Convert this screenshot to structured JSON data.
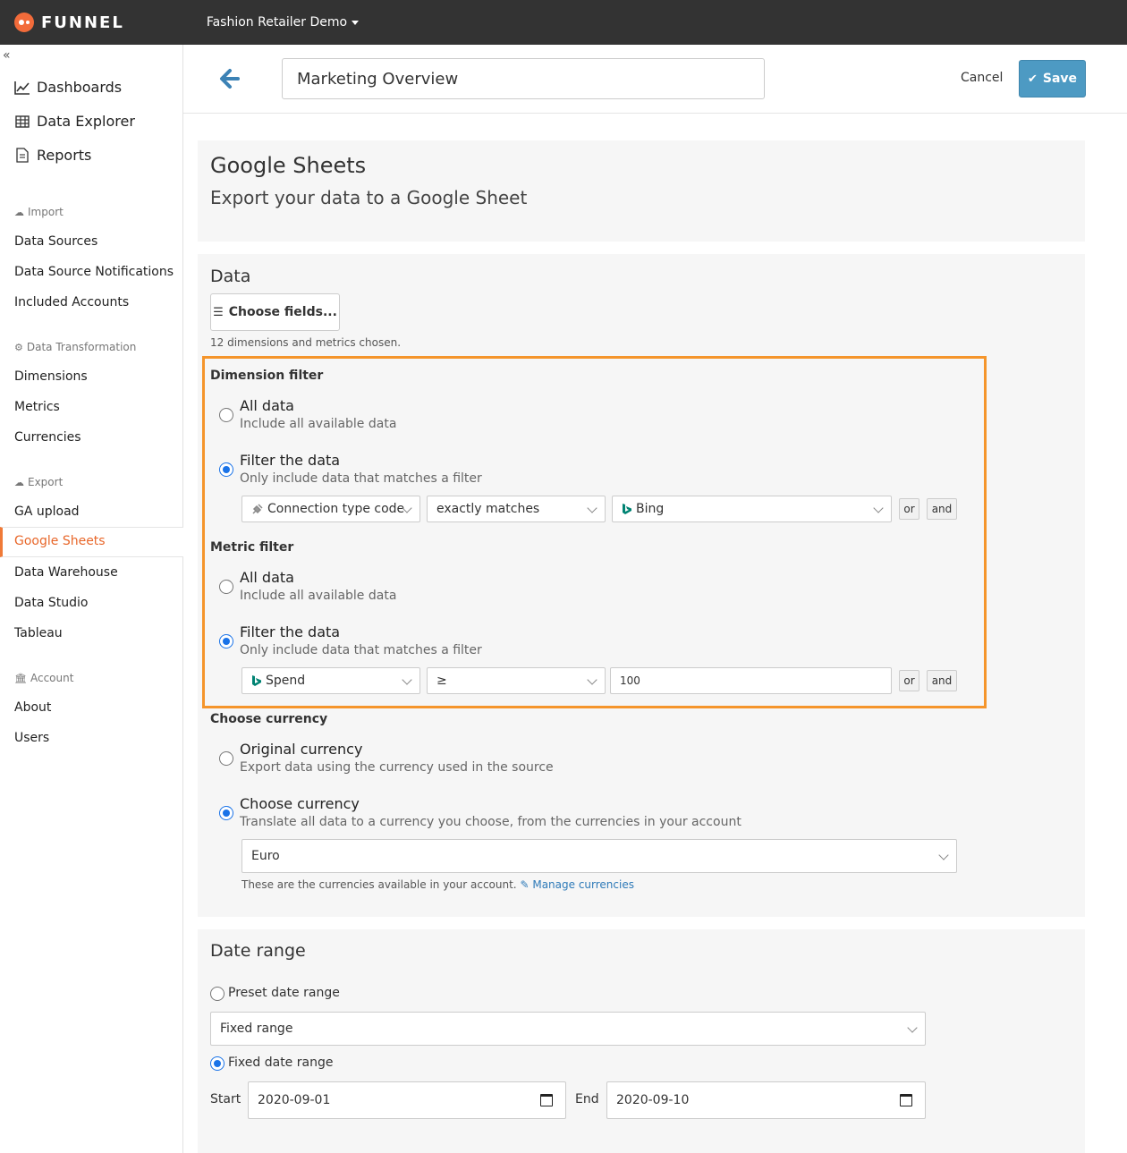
{
  "app": {
    "brand": "FUNNEL",
    "workspace": "Fashion Retailer Demo"
  },
  "sidebar": {
    "collapse_glyph": "«",
    "main": [
      {
        "label": "Dashboards",
        "icon": "line-chart-icon"
      },
      {
        "label": "Data Explorer",
        "icon": "table-icon"
      },
      {
        "label": "Reports",
        "icon": "document-icon"
      }
    ],
    "sections": {
      "import": "Import",
      "transform": "Data Transformation",
      "export": "Export",
      "account": "Account"
    },
    "import_items": [
      "Data Sources",
      "Data Source Notifications",
      "Included Accounts"
    ],
    "transform_items": [
      "Dimensions",
      "Metrics",
      "Currencies"
    ],
    "export_items": [
      "GA upload",
      "Google Sheets",
      "Data Warehouse",
      "Data Studio",
      "Tableau"
    ],
    "account_items": [
      "About",
      "Users"
    ],
    "active": "Google Sheets"
  },
  "header": {
    "title_value": "Marketing Overview",
    "cancel": "Cancel",
    "save": "Save"
  },
  "intro": {
    "title": "Google Sheets",
    "subtitle": "Export your data to a Google Sheet"
  },
  "data": {
    "heading": "Data",
    "choose_fields": "Choose fields...",
    "chosen_note": "12 dimensions and metrics chosen.",
    "dimension_filter": {
      "label": "Dimension filter",
      "options": [
        {
          "title": "All data",
          "desc": "Include all available data",
          "checked": false
        },
        {
          "title": "Filter the data",
          "desc": "Only include data that matches a filter",
          "checked": true
        }
      ],
      "field": "Connection type code",
      "operator": "exactly matches",
      "value": "Bing",
      "or": "or",
      "and": "and"
    },
    "metric_filter": {
      "label": "Metric filter",
      "options": [
        {
          "title": "All data",
          "desc": "Include all available data",
          "checked": false
        },
        {
          "title": "Filter the data",
          "desc": "Only include data that matches a filter",
          "checked": true
        }
      ],
      "field": "Spend",
      "operator": "≥",
      "value": "100",
      "or": "or",
      "and": "and"
    },
    "currency": {
      "label": "Choose currency",
      "options": [
        {
          "title": "Original currency",
          "desc": "Export data using the currency used in the source",
          "checked": false
        },
        {
          "title": "Choose currency",
          "desc": "Translate all data to a currency you choose, from the currencies in your account",
          "checked": true
        }
      ],
      "selected": "Euro",
      "note": "These are the currencies available in your account.",
      "manage_link": "Manage currencies"
    }
  },
  "date_range": {
    "heading": "Date range",
    "preset_label": "Preset date range",
    "preset_checked": false,
    "preset_value": "Fixed range",
    "fixed_label": "Fixed date range",
    "fixed_checked": true,
    "start_label": "Start",
    "start_value": "2020-09-01",
    "end_label": "End",
    "end_value": "2020-09-10"
  },
  "colors": {
    "topbar": "#333333",
    "brand_orange": "#f26b3a",
    "active_nav": "#e8672a",
    "save_button": "#4d9ac3",
    "highlight_border": "#f5952b",
    "radio_checked": "#1a73e8",
    "bing_teal": "#008373"
  }
}
